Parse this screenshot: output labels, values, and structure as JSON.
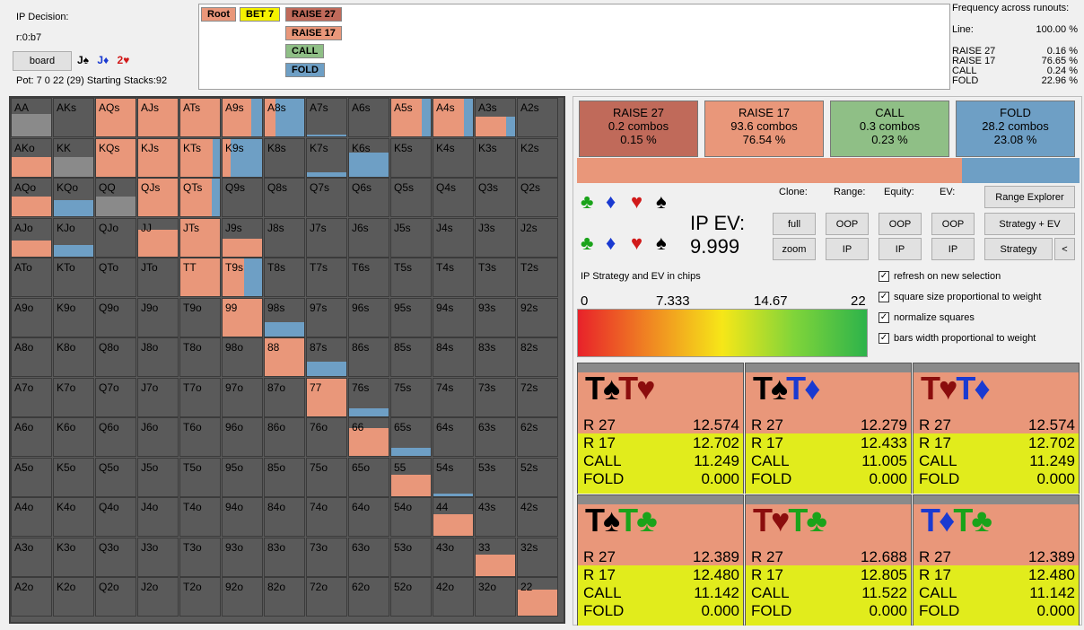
{
  "decision": {
    "title": "IP Decision:",
    "node": "r:0:b7",
    "board_button": "board",
    "board_cards": [
      {
        "text": "J♠",
        "color": "#000000"
      },
      {
        "text": "J♦",
        "color": "#1a3ad1"
      },
      {
        "text": "2♥",
        "color": "#d11a1a"
      }
    ],
    "pot": "Pot: 7 0 22 (29) Starting Stacks:92"
  },
  "tree": {
    "path": [
      {
        "label": "Root",
        "color": "#e9977a"
      },
      {
        "label": "BET 7",
        "color": "#f6f200"
      },
      {
        "label": "RAISE 27",
        "color": "#c06a5a"
      }
    ],
    "options": [
      {
        "label": "RAISE 17",
        "color": "#e9977a"
      },
      {
        "label": "CALL",
        "color": "#8fbf86"
      },
      {
        "label": "FOLD",
        "color": "#6e9fc5"
      }
    ]
  },
  "frequency": {
    "title": "Frequency across runouts:",
    "line_label": "Line:",
    "line_value": "100.00 %",
    "rows": [
      {
        "label": "RAISE 27",
        "value": "0.16 %"
      },
      {
        "label": "RAISE 17",
        "value": "76.65 %"
      },
      {
        "label": "CALL",
        "value": "0.24 %"
      },
      {
        "label": "FOLD",
        "value": "22.96 %"
      }
    ]
  },
  "colors": {
    "raise27": "#c06a5a",
    "raise17": "#e9977a",
    "call": "#8fbf86",
    "fold": "#6e9fc5",
    "empty": "#5a5a5a",
    "grey": "#8a8a8a"
  },
  "grid": {
    "rows": [
      [
        "AA",
        "AKs",
        "AQs",
        "AJs",
        "ATs",
        "A9s",
        "A8s",
        "A7s",
        "A6s",
        "A5s",
        "A4s",
        "A3s",
        "A2s"
      ],
      [
        "AKo",
        "KK",
        "KQs",
        "KJs",
        "KTs",
        "K9s",
        "K8s",
        "K7s",
        "K6s",
        "K5s",
        "K4s",
        "K3s",
        "K2s"
      ],
      [
        "AQo",
        "KQo",
        "QQ",
        "QJs",
        "QTs",
        "Q9s",
        "Q8s",
        "Q7s",
        "Q6s",
        "Q5s",
        "Q4s",
        "Q3s",
        "Q2s"
      ],
      [
        "AJo",
        "KJo",
        "QJo",
        "JJ",
        "JTs",
        "J9s",
        "J8s",
        "J7s",
        "J6s",
        "J5s",
        "J4s",
        "J3s",
        "J2s"
      ],
      [
        "ATo",
        "KTo",
        "QTo",
        "JTo",
        "TT",
        "T9s",
        "T8s",
        "T7s",
        "T6s",
        "T5s",
        "T4s",
        "T3s",
        "T2s"
      ],
      [
        "A9o",
        "K9o",
        "Q9o",
        "J9o",
        "T9o",
        "99",
        "98s",
        "97s",
        "96s",
        "95s",
        "94s",
        "93s",
        "92s"
      ],
      [
        "A8o",
        "K8o",
        "Q8o",
        "J8o",
        "T8o",
        "98o",
        "88",
        "87s",
        "86s",
        "85s",
        "84s",
        "83s",
        "82s"
      ],
      [
        "A7o",
        "K7o",
        "Q7o",
        "J7o",
        "T7o",
        "97o",
        "87o",
        "77",
        "76s",
        "75s",
        "74s",
        "73s",
        "72s"
      ],
      [
        "A6o",
        "K6o",
        "Q6o",
        "J6o",
        "T6o",
        "96o",
        "86o",
        "76o",
        "66",
        "65s",
        "64s",
        "63s",
        "62s"
      ],
      [
        "A5o",
        "K5o",
        "Q5o",
        "J5o",
        "T5o",
        "95o",
        "85o",
        "75o",
        "65o",
        "55",
        "54s",
        "53s",
        "52s"
      ],
      [
        "A4o",
        "K4o",
        "Q4o",
        "J4o",
        "T4o",
        "94o",
        "84o",
        "74o",
        "64o",
        "54o",
        "44",
        "43s",
        "42s"
      ],
      [
        "A3o",
        "K3o",
        "Q3o",
        "J3o",
        "T3o",
        "93o",
        "83o",
        "73o",
        "63o",
        "53o",
        "43o",
        "33",
        "32s"
      ],
      [
        "A2o",
        "K2o",
        "Q2o",
        "J2o",
        "T2o",
        "92o",
        "82o",
        "72o",
        "62o",
        "52o",
        "42o",
        "32o",
        "22"
      ]
    ],
    "strategy": {
      "AA": {
        "weight": 0.62,
        "raise17": 0,
        "fold": 0,
        "grey": 1
      },
      "AKs": {
        "weight": 0,
        "raise17": 0,
        "fold": 0
      },
      "AQs": {
        "weight": 1,
        "raise17": 1,
        "fold": 0
      },
      "AJs": {
        "weight": 1,
        "raise17": 1,
        "fold": 0
      },
      "ATs": {
        "weight": 1,
        "raise17": 1,
        "fold": 0
      },
      "A9s": {
        "weight": 1,
        "raise17": 0.72,
        "fold": 0.28
      },
      "A8s": {
        "weight": 1,
        "raise17": 0.28,
        "fold": 0.72
      },
      "A7s": {
        "weight": 0.08,
        "raise17": 0,
        "fold": 1
      },
      "A5s": {
        "weight": 1,
        "raise17": 0.78,
        "fold": 0.22
      },
      "A4s": {
        "weight": 1,
        "raise17": 0.78,
        "fold": 0.22
      },
      "A3s": {
        "weight": 0.55,
        "raise17": 0.78,
        "fold": 0.22
      },
      "AKo": {
        "weight": 0.55,
        "raise17": 1,
        "fold": 0
      },
      "KK": {
        "weight": 0.55,
        "raise17": 0,
        "fold": 0,
        "grey": 1
      },
      "KQs": {
        "weight": 1,
        "raise17": 1,
        "fold": 0
      },
      "KJs": {
        "weight": 1,
        "raise17": 1,
        "fold": 0
      },
      "KTs": {
        "weight": 1,
        "raise17": 0.82,
        "fold": 0.18
      },
      "K9s": {
        "weight": 1,
        "raise17": 0.2,
        "fold": 0.8
      },
      "K7s": {
        "weight": 0.15,
        "raise17": 0,
        "fold": 1
      },
      "K6s": {
        "weight": 0.65,
        "raise17": 0,
        "fold": 1
      },
      "AQo": {
        "weight": 0.55,
        "raise17": 1,
        "fold": 0
      },
      "KQo": {
        "weight": 0.45,
        "raise17": 0,
        "fold": 1
      },
      "QQ": {
        "weight": 0.55,
        "raise17": 0,
        "fold": 0,
        "grey": 1
      },
      "QJs": {
        "weight": 1,
        "raise17": 1,
        "fold": 0
      },
      "QTs": {
        "weight": 1,
        "raise17": 0.8,
        "fold": 0.2
      },
      "AJo": {
        "weight": 0.45,
        "raise17": 1,
        "fold": 0
      },
      "KJo": {
        "weight": 0.35,
        "raise17": 0,
        "fold": 1
      },
      "JJ": {
        "weight": 0.72,
        "raise17": 1,
        "fold": 0
      },
      "JTs": {
        "weight": 1,
        "raise17": 1,
        "fold": 0
      },
      "J9s": {
        "weight": 0.5,
        "raise17": 1,
        "fold": 0
      },
      "TT": {
        "weight": 1,
        "raise17": 1,
        "fold": 0
      },
      "T9s": {
        "weight": 1,
        "raise17": 0.55,
        "fold": 0.45
      },
      "99": {
        "weight": 1,
        "raise17": 1,
        "fold": 0
      },
      "98s": {
        "weight": 0.4,
        "raise17": 0,
        "fold": 1
      },
      "88": {
        "weight": 1,
        "raise17": 1,
        "fold": 0
      },
      "87s": {
        "weight": 0.4,
        "raise17": 0,
        "fold": 1
      },
      "77": {
        "weight": 1,
        "raise17": 1,
        "fold": 0
      },
      "76s": {
        "weight": 0.25,
        "raise17": 0,
        "fold": 1
      },
      "66": {
        "weight": 0.75,
        "raise17": 1,
        "fold": 0
      },
      "65s": {
        "weight": 0.25,
        "raise17": 0,
        "fold": 1
      },
      "55": {
        "weight": 0.6,
        "raise17": 1,
        "fold": 0
      },
      "54s": {
        "weight": 0.12,
        "raise17": 0,
        "fold": 1
      },
      "44": {
        "weight": 0.6,
        "raise17": 1,
        "fold": 0
      },
      "33": {
        "weight": 0.6,
        "raise17": 1,
        "fold": 0
      },
      "22": {
        "weight": 0.7,
        "raise17": 1,
        "fold": 0
      }
    }
  },
  "actions": [
    {
      "name": "RAISE 27",
      "combos": "0.2 combos",
      "pct": "0.15 %",
      "color": "#c06a5a"
    },
    {
      "name": "RAISE 17",
      "combos": "93.6 combos",
      "pct": "76.54 %",
      "color": "#e9977a"
    },
    {
      "name": "CALL",
      "combos": "0.3 combos",
      "pct": "0.23 %",
      "color": "#8fbf86"
    },
    {
      "name": "FOLD",
      "combos": "28.2 combos",
      "pct": "23.08 %",
      "color": "#6e9fc5"
    }
  ],
  "combined_bar": {
    "raise_fraction": 0.7654,
    "fold_fraction": 0.2308
  },
  "controls": {
    "clone_label": "Clone:",
    "range_label": "Range:",
    "equity_label": "Equity:",
    "ev_label": "EV:",
    "full": "full",
    "zoom": "zoom",
    "oop": "OOP",
    "ip": "IP",
    "range_explorer": "Range Explorer",
    "strategy_ev": "Strategy + EV",
    "strategy": "Strategy",
    "collapse": "<",
    "ev_title": "IP EV:",
    "ev_value": "9.999"
  },
  "suit_filters": [
    {
      "glyph": "♣",
      "color": "#1aa31a",
      "name": "club-icon"
    },
    {
      "glyph": "♦",
      "color": "#1a3ad1",
      "name": "diamond-icon"
    },
    {
      "glyph": "♥",
      "color": "#d11a1a",
      "name": "heart-icon"
    },
    {
      "glyph": "♠",
      "color": "#000000",
      "name": "spade-icon"
    }
  ],
  "legend": {
    "title": "IP Strategy and EV in chips",
    "ticks": [
      "0",
      "7.333",
      "14.67",
      "22"
    ]
  },
  "checkboxes": [
    {
      "label": "refresh on new selection",
      "checked": "✓"
    },
    {
      "label": "square size proportional to weight",
      "checked": "✓"
    },
    {
      "label": "normalize squares",
      "checked": "✓"
    },
    {
      "label": "bars width proportional to weight",
      "checked": "✓"
    }
  ],
  "runouts": [
    {
      "cards": [
        {
          "t": "T♠",
          "c": "#000000"
        },
        {
          "t": "T♥",
          "c": "#8b0d0d"
        }
      ],
      "rows": [
        [
          "R 27",
          "12.574"
        ],
        [
          "R 17",
          "12.702"
        ],
        [
          "CALL",
          "11.249"
        ],
        [
          "FOLD",
          "0.000"
        ]
      ]
    },
    {
      "cards": [
        {
          "t": "T♠",
          "c": "#000000"
        },
        {
          "t": "T♦",
          "c": "#1a3ad1"
        }
      ],
      "rows": [
        [
          "R 27",
          "12.279"
        ],
        [
          "R 17",
          "12.433"
        ],
        [
          "CALL",
          "11.005"
        ],
        [
          "FOLD",
          "0.000"
        ]
      ]
    },
    {
      "cards": [
        {
          "t": "T♥",
          "c": "#8b0d0d"
        },
        {
          "t": "T♦",
          "c": "#1a3ad1"
        }
      ],
      "rows": [
        [
          "R 27",
          "12.574"
        ],
        [
          "R 17",
          "12.702"
        ],
        [
          "CALL",
          "11.249"
        ],
        [
          "FOLD",
          "0.000"
        ]
      ]
    },
    {
      "cards": [
        {
          "t": "T♠",
          "c": "#000000"
        },
        {
          "t": "T♣",
          "c": "#1aa31a"
        }
      ],
      "rows": [
        [
          "R 27",
          "12.389"
        ],
        [
          "R 17",
          "12.480"
        ],
        [
          "CALL",
          "11.142"
        ],
        [
          "FOLD",
          "0.000"
        ]
      ]
    },
    {
      "cards": [
        {
          "t": "T♥",
          "c": "#8b0d0d"
        },
        {
          "t": "T♣",
          "c": "#1aa31a"
        }
      ],
      "rows": [
        [
          "R 27",
          "12.688"
        ],
        [
          "R 17",
          "12.805"
        ],
        [
          "CALL",
          "11.522"
        ],
        [
          "FOLD",
          "0.000"
        ]
      ]
    },
    {
      "cards": [
        {
          "t": "T♦",
          "c": "#1a3ad1"
        },
        {
          "t": "T♣",
          "c": "#1aa31a"
        }
      ],
      "rows": [
        [
          "R 27",
          "12.389"
        ],
        [
          "R 17",
          "12.480"
        ],
        [
          "CALL",
          "11.142"
        ],
        [
          "FOLD",
          "0.000"
        ]
      ]
    }
  ]
}
